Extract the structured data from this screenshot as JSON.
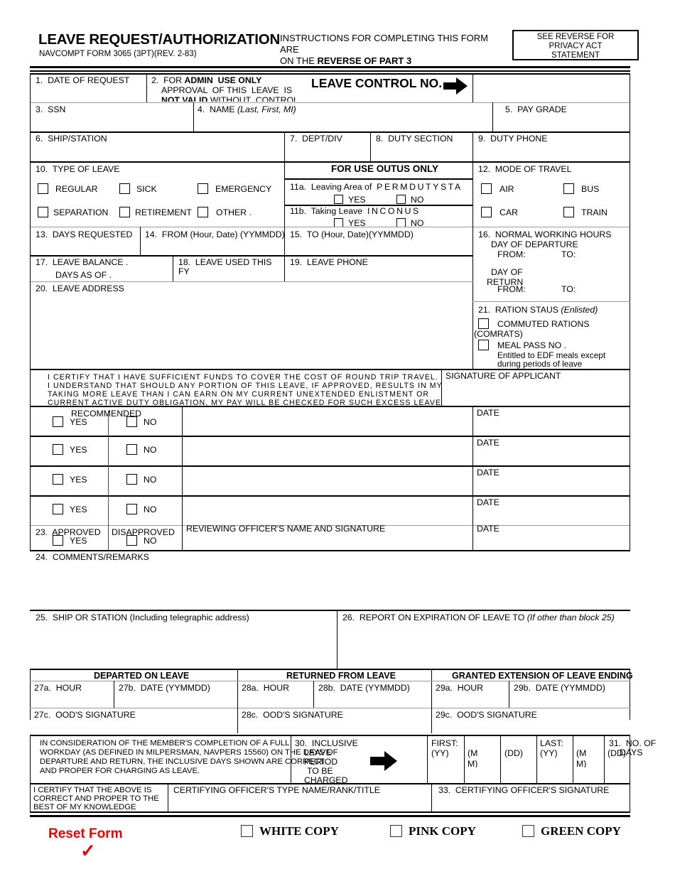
{
  "header": {
    "title": "LEAVE REQUEST/AUTHORIZATION",
    "form_id": "NAVCOMPT FORM 3065 (3PT)(REV. 2-83)",
    "instructions_line1": "INSTRUCTIONS FOR COMPLETING THIS FORM ARE",
    "instructions_line2_prefix": "ON THE ",
    "instructions_line2_bold": "REVERSE OF PART 3",
    "privacy_line1": "SEE REVERSE FOR",
    "privacy_line2": "PRIVACY ACT",
    "privacy_line3": "STATEMENT"
  },
  "block1": {
    "label": "1.  DATE OF REQUEST",
    "value": ""
  },
  "block2": {
    "label_prefix": "2.  FOR ",
    "label_bold": "ADMIN  USE ONLY",
    "line2": "APPROVAL  OF THIS  LEAVE  IS",
    "line3_bold": "NOT VALID",
    "line3_rest": " WITHOUT  CONTROL",
    "control_no_label": "LEAVE CONTROL NO.",
    "control_no_value": ""
  },
  "block3": {
    "label": "3.  SSN",
    "value": ""
  },
  "block4": {
    "label_prefix": "4.  NAME ",
    "label_italic": "(Last, First, MI)",
    "value": ""
  },
  "block5": {
    "label": "5.  PAY GRADE",
    "value": ""
  },
  "block6": {
    "label": "6.  SHIP/STATION",
    "value": ""
  },
  "block7": {
    "label": "7.  DEPT/DIV",
    "value": ""
  },
  "block8": {
    "label": "8.  DUTY SECTION",
    "value": ""
  },
  "block9": {
    "label": "9.  DUTY PHONE",
    "value": ""
  },
  "block10": {
    "label": "10.  TYPE OF LEAVE",
    "options": [
      {
        "label": "REGULAR",
        "checked": false
      },
      {
        "label": "SICK",
        "checked": false
      },
      {
        "label": "EMERGENCY",
        "checked": false
      },
      {
        "label": "SEPARATION",
        "checked": false
      },
      {
        "label": "RETIREMENT",
        "checked": false
      },
      {
        "label": "OTHER .",
        "checked": false
      }
    ]
  },
  "outus": {
    "heading": "FOR USE OUTUS ONLY",
    "block11a": {
      "label_prefix": "11a.  Leaving Area of  ",
      "label_spaced": "PERMDUTYSTA",
      "yes": "YES",
      "no": "NO",
      "yes_checked": false,
      "no_checked": false
    },
    "block11b": {
      "label_prefix": "11b.  Taking Leave  ",
      "label_spaced": "INCONUS",
      "yes": "YES",
      "no": "NO",
      "yes_checked": false,
      "no_checked": false
    }
  },
  "block12": {
    "label": "12.  MODE OF TRAVEL",
    "options": [
      {
        "label": "AIR",
        "checked": false
      },
      {
        "label": "BUS",
        "checked": false
      },
      {
        "label": "CAR",
        "checked": false
      },
      {
        "label": "TRAIN",
        "checked": false
      }
    ]
  },
  "block13": {
    "label": "13.  DAYS REQUESTED",
    "value": ""
  },
  "block14": {
    "label": "14.  FROM (Hour, Date) (YYMMDD)",
    "value": ""
  },
  "block15": {
    "label": "15.  TO (Hour, Date)(YYMMDD)",
    "value": ""
  },
  "block16": {
    "label": "16.  NORMAL WORKING HOURS",
    "departure_heading": "DAY OF DEPARTURE",
    "departure_from": "FROM:",
    "departure_to": "TO:",
    "return_heading_line1": "DAY OF",
    "return_heading_line2": "RETURN",
    "return_from": "FROM:",
    "return_to": "TO:"
  },
  "block17": {
    "label_line1": "17.  LEAVE BALANCE .",
    "label_line2": "DAYS AS OF .",
    "value": ""
  },
  "block18": {
    "label_line1": "18.  LEAVE USED THIS",
    "label_line2": "FY",
    "value": ""
  },
  "block19": {
    "label": "19.  LEAVE PHONE",
    "value": ""
  },
  "block20": {
    "label": "20.  LEAVE ADDRESS",
    "value": ""
  },
  "block21": {
    "label_prefix": "21.  RATION STAUS ",
    "label_italic": "(Enlisted)",
    "comrats_line1": "COMMUTED RATIONS",
    "comrats_line2": "(COMRATS)",
    "comrats_checked": false,
    "mealpass_label": "MEAL PASS NO .",
    "mealpass_checked": false,
    "mealpass_note_line1": "Entitled to EDF meals except",
    "mealpass_note_line2": "during periods of leave"
  },
  "certification": {
    "line1": "I CERTIFY THAT I HAVE SUFFICIENT FUNDS TO COVER THE COST OF ROUND TRIP TRAVEL.",
    "line2": "I UNDERSTAND THAT SHOULD ANY PORTION OF THIS LEAVE, IF APPROVED, RESULTS IN MY",
    "line3": "TAKING MORE LEAVE THAN I CAN EARN ON MY CURRENT UNEXTENDED ENLISTMENT OR",
    "line4": "CURRENT ACTIVE DUTY OBLIGATION, MY PAY WILL BE CHECKED FOR SUCH EXCESS LEAVE",
    "signature_label": "SIGNATURE OF APPLICANT",
    "signature_value": ""
  },
  "recommendation": {
    "heading": "RECOMMENDED",
    "rows": [
      {
        "yes": "YES",
        "no": "NO",
        "yes_checked": false,
        "no_checked": false,
        "signature": "",
        "date_label": "DATE",
        "date_value": ""
      },
      {
        "yes": "YES",
        "no": "NO",
        "yes_checked": false,
        "no_checked": false,
        "signature": "",
        "date_label": "DATE",
        "date_value": ""
      },
      {
        "yes": "YES",
        "no": "NO",
        "yes_checked": false,
        "no_checked": false,
        "signature": "",
        "date_label": "DATE",
        "date_value": ""
      },
      {
        "yes": "YES",
        "no": "NO",
        "yes_checked": false,
        "no_checked": false,
        "signature": "",
        "date_label": "DATE",
        "date_value": ""
      }
    ]
  },
  "block23": {
    "approved_label": "23.  APPROVED",
    "disapproved_label": "DISAPPROVED",
    "yes": "YES",
    "no": "NO",
    "yes_checked": false,
    "no_checked": false,
    "reviewing_officer_label": "REVIEWING OFFICER'S NAME AND SIGNATURE",
    "reviewing_officer_value": "",
    "date_label": "DATE",
    "date_value": ""
  },
  "block24": {
    "label": "24.  COMMENTS/REMARKS",
    "value": ""
  },
  "block25": {
    "label": "25.  SHIP OR STATION (Including telegraphic address)",
    "value": ""
  },
  "block26": {
    "label_prefix": "26.  REPORT ON EXPIRATION OF LEAVE TO ",
    "label_italic": "(If other than block 25)",
    "value": ""
  },
  "leave_status": {
    "departed_heading": "DEPARTED ON LEAVE",
    "returned_heading": "RETURNED FROM LEAVE",
    "extension_heading": "GRANTED EXTENSION OF LEAVE ENDING",
    "fields": [
      {
        "label": "27a.  HOUR",
        "value": ""
      },
      {
        "label": "27b.  DATE (YYMMDD)",
        "value": ""
      },
      {
        "label": "28a.  HOUR",
        "value": ""
      },
      {
        "label": "28b.  DATE (YYMMDD)",
        "value": ""
      },
      {
        "label": "29a.  HOUR",
        "value": ""
      },
      {
        "label": "29b.  DATE (YYMMDD)",
        "value": ""
      }
    ],
    "signatures": [
      {
        "label": "27c.  OOD'S SIGNATURE",
        "value": ""
      },
      {
        "label": "28c.  OOD'S SIGNATURE",
        "value": ""
      },
      {
        "label": "29c.  OOD'S SIGNATURE",
        "value": ""
      }
    ]
  },
  "inclusive": {
    "statement_line1": "IN CONSIDERATION OF THE MEMBER'S COMPLETION OF A FULL",
    "statement_line2": "WORKDAY (AS DEFINED IN MILPERSMAN, NAVPERS 15560) ON THE DAYS OF",
    "statement_line3": "DEPARTURE AND RETURN, THE INCLUSIVE DAYS SHOWN ARE CORRECT",
    "statement_line4": "AND PROPER FOR CHARGING AS LEAVE.",
    "block30_line1": "30.  INCLUSIVE",
    "block30_line2": "LEAVE",
    "block30_line3": "PERIOD",
    "block30_line4": "TO BE",
    "block30_line5": "CHARGED",
    "first_label": "FIRST:",
    "first_yy": "(YY)",
    "first_mm": "(MM)",
    "first_dd": "(DD)",
    "last_label": "LAST:",
    "last_yy": "(YY)",
    "last_mm": "(MM)",
    "last_dd": "(DD)",
    "first_yy_value": "",
    "first_mm_value": "",
    "first_dd_value": "",
    "last_yy_value": "",
    "last_mm_value": "",
    "last_dd_value": "",
    "block31_line1": "31.  NO. OF",
    "block31_line2": "DAYS",
    "block31_value": ""
  },
  "certifying": {
    "statement_line1": "I CERTIFY THAT THE ABOVE IS",
    "statement_line2": "CORRECT AND PROPER TO THE",
    "statement_line3": "BEST OF MY KNOWLEDGE",
    "officer_name_label": "CERTIFYING OFFICER'S TYPE NAME/RANK/TITLE",
    "officer_name_value": "",
    "block33_label": "33.  CERTIFYING OFFICER'S SIGNATURE",
    "block33_value": ""
  },
  "footer": {
    "reset_label": "Reset Form",
    "reset_check_glyph": "✓",
    "reset_color": "#ee0000",
    "copies": [
      {
        "label": "WHITE COPY",
        "checked": false
      },
      {
        "label": "PINK COPY",
        "checked": false
      },
      {
        "label": "GREEN COPY",
        "checked": false
      }
    ]
  }
}
